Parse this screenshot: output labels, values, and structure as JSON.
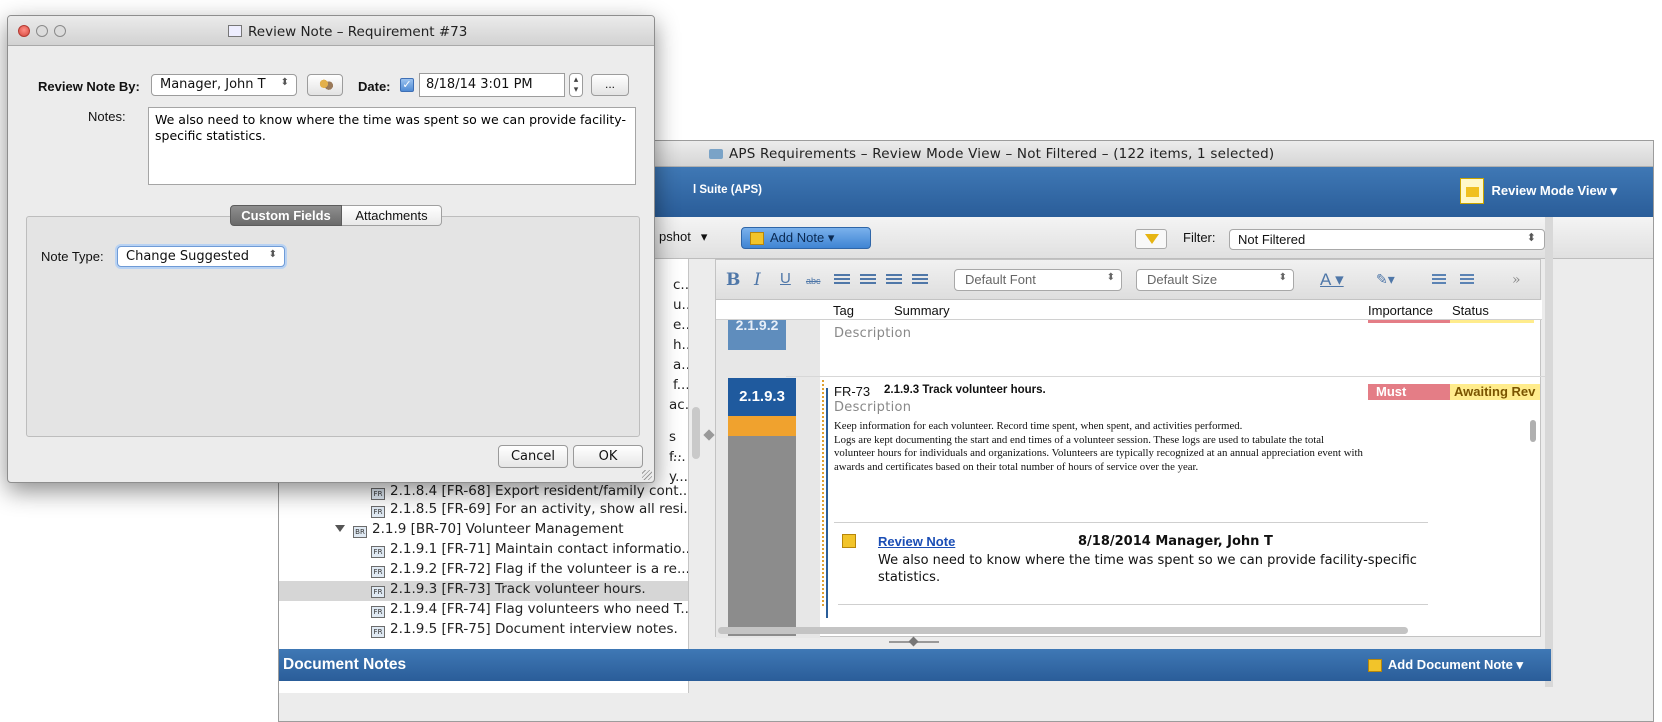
{
  "main_window": {
    "title": "APS Requirements – Review Mode View – Not Filtered – (122 items, 1 selected)",
    "suite_name": "l Suite (APS)",
    "view_switch_label": "Review Mode View ▾",
    "toolbar": {
      "snapshot_label": "pshot",
      "add_note_label": "Add Note ▾",
      "filter_label": "Filter:",
      "filter_value": "Not Filtered"
    },
    "format_bar": {
      "bold": "B",
      "italic": "I",
      "underline": "U",
      "strike": "abc",
      "font_value": "Default Font",
      "size_value": "Default Size",
      "text_color": "A",
      "overflow": "»"
    },
    "tree": {
      "fragments": [
        "c...",
        "u...",
        "e...",
        "h...",
        "a...",
        "f...",
        "ac...",
        "s ...",
        "f...",
        "y..."
      ],
      "items": [
        {
          "text": "2.1.8.4 [FR-68] Export resident/family cont...",
          "icon": "FR",
          "partial": true
        },
        {
          "text": "2.1.8.5 [FR-69] For an activity, show all resi...",
          "icon": "FR"
        },
        {
          "text": "2.1.9 [BR-70] Volunteer Management",
          "icon": "BR",
          "group": true
        },
        {
          "text": "2.1.9.1 [FR-71] Maintain contact informatio...",
          "icon": "FR"
        },
        {
          "text": "2.1.9.2 [FR-72] Flag if the volunteer is a re...",
          "icon": "FR"
        },
        {
          "text": "2.1.9.3 [FR-73] Track volunteer hours.",
          "icon": "FR",
          "selected": true
        },
        {
          "text": "2.1.9.4 [FR-74] Flag volunteers who need T...",
          "icon": "FR"
        },
        {
          "text": "2.1.9.5 [FR-75] Document interview notes.",
          "icon": "FR"
        }
      ]
    },
    "columns": {
      "tag": "Tag",
      "summary": "Summary",
      "importance": "Importance",
      "status": "Status"
    },
    "prev_requirement": {
      "number": "2.1.9.2",
      "description_label": "Description"
    },
    "requirement": {
      "number": "2.1.9.3",
      "tag": "FR-73",
      "title": "2.1.9.3  Track volunteer hours.",
      "importance": "Must",
      "status": "Awaiting Rev",
      "description_label": "Description",
      "description_lines": [
        "Keep information for each volunteer. Record time spent, when spent, and activities performed.",
        "Logs are kept documenting the start and end times of a volunteer session. These logs are used to tabulate the total",
        "volunteer hours for individuals and organizations. Volunteers are typically recognized at an annual appreciation event with",
        "awards and certificates based on their total number of hours of service over the year."
      ],
      "review_note": {
        "link_label": "Review Note",
        "meta": "8/18/2014 Manager, John T",
        "text": "We also need to know where the time was spent so we can provide facility-specific statistics."
      }
    },
    "document_notes": {
      "title": "Document Notes",
      "add_label": "Add Document Note ▾"
    }
  },
  "dialog": {
    "title": "Review Note – Requirement #73",
    "review_by_label": "Review Note By:",
    "reviewer_value": "Manager, John T",
    "date_label": "Date:",
    "date_checked": true,
    "date_value": "8/18/14 3:01 PM",
    "more_button": "...",
    "notes_label": "Notes:",
    "notes_value": "We also need to know where the time was spent so we can provide facility-specific statistics.",
    "tabs": [
      "Custom Fields",
      "Attachments"
    ],
    "note_type_label": "Note Type:",
    "note_type_value": "Change Suggested",
    "cancel_label": "Cancel",
    "ok_label": "OK"
  },
  "colors": {
    "header_blue": "#2a5d99",
    "must_red": "#e47d86",
    "status_yellow": "#ffec8c",
    "accent_orange": "#f0a22e"
  }
}
